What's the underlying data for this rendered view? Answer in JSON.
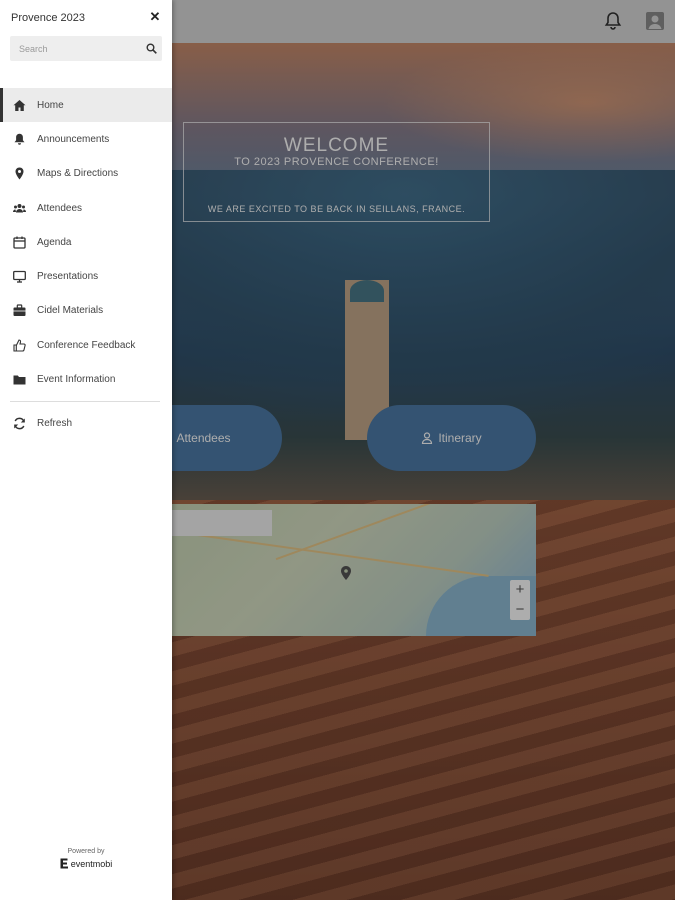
{
  "drawer": {
    "title": "Provence 2023",
    "search_placeholder": "Search",
    "menu": [
      {
        "label": "Home",
        "icon": "home-icon",
        "active": true
      },
      {
        "label": "Announcements",
        "icon": "bell-icon"
      },
      {
        "label": "Maps & Directions",
        "icon": "map-pin-icon"
      },
      {
        "label": "Attendees",
        "icon": "users-icon"
      },
      {
        "label": "Agenda",
        "icon": "calendar-icon"
      },
      {
        "label": "Presentations",
        "icon": "monitor-icon"
      },
      {
        "label": "Cidel Materials",
        "icon": "briefcase-icon"
      },
      {
        "label": "Conference Feedback",
        "icon": "thumbs-up-icon"
      },
      {
        "label": "Event Information",
        "icon": "folder-icon"
      }
    ],
    "refresh_label": "Refresh",
    "powered_by": "Powered by",
    "brand": "eventmobi"
  },
  "hero": {
    "welcome_title": "WELCOME",
    "welcome_subtitle": "TO 2023 PROVENCE CONFERENCE!",
    "welcome_note": "WE ARE EXCITED TO BE BACK IN SEILLANS, FRANCE."
  },
  "buttons": {
    "attendees": "Attendees",
    "itinerary": "Itinerary"
  },
  "map": {
    "zoom_in": "+",
    "zoom_out": "−"
  },
  "colors": {
    "accent_button": "#4d7ba8",
    "drawer_bg": "#ffffff",
    "active_item_bg": "#ebebeb"
  }
}
